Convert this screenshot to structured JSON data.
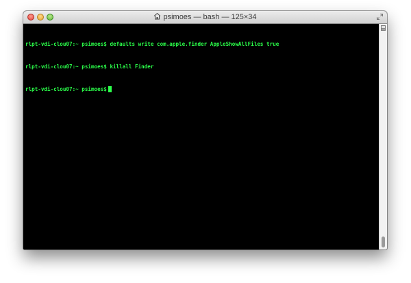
{
  "window": {
    "title": "psimoes — bash — 125×34"
  },
  "terminal": {
    "lines": [
      {
        "prompt": "rlpt-vdi-clou07:~ psimoes$",
        "command": " defaults write com.apple.finder AppleShowAllFiles true"
      },
      {
        "prompt": "rlpt-vdi-clou07:~ psimoes$",
        "command": " killall Finder"
      },
      {
        "prompt": "rlpt-vdi-clou07:~ psimoes$",
        "command": ""
      }
    ]
  },
  "colors": {
    "terminal_text": "#2bff4a",
    "terminal_bg": "#000000"
  },
  "icons": {
    "title": "home-icon",
    "resize": "fullscreen-icon"
  }
}
